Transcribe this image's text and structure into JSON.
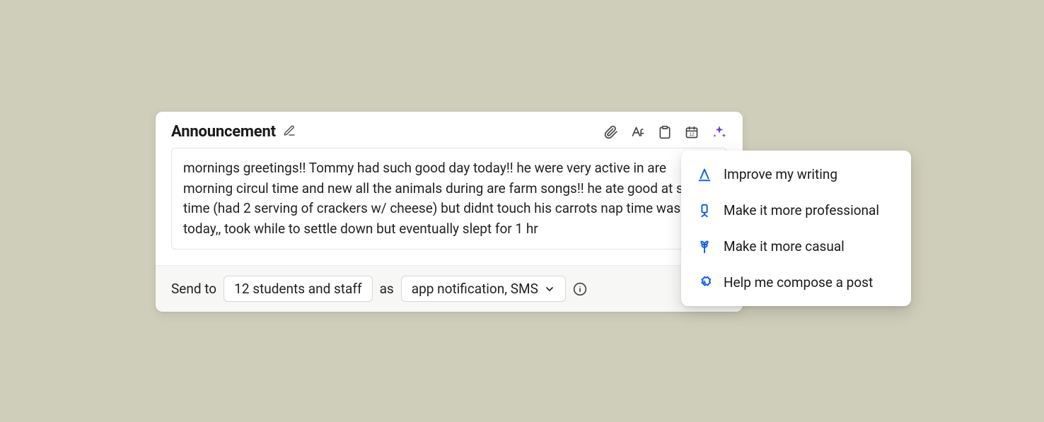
{
  "header": {
    "title": "Announcement"
  },
  "body": {
    "text": "mornings greetings!! Tommy had such good day today!! he were very active in are morning circul time and new all the animals during are farm songs!! he ate good at snack time (had 2 serving of crackers w/ cheese) but didnt touch his carrots nap time was ruff today,, took while to settle down but eventually slept for 1 hr"
  },
  "footer": {
    "send_to_label": "Send to",
    "recipients": "12 students and staff",
    "as_label": "as",
    "delivery": "app notification, SMS"
  },
  "ai_menu": {
    "items": [
      {
        "label": "Improve my writing"
      },
      {
        "label": "Make it more professional"
      },
      {
        "label": "Make it more casual"
      },
      {
        "label": "Help me compose a post"
      }
    ]
  }
}
